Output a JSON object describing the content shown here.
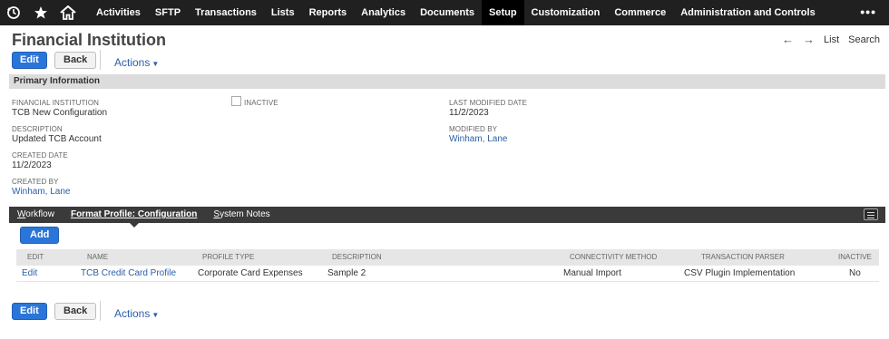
{
  "nav": {
    "icons": [
      "recent-icon",
      "star-icon",
      "home-icon"
    ],
    "items": [
      "Activities",
      "SFTP",
      "Transactions",
      "Lists",
      "Reports",
      "Analytics",
      "Documents",
      "Setup",
      "Customization",
      "Commerce",
      "Administration and Controls"
    ],
    "active_item": "Setup",
    "more": "•••"
  },
  "page": {
    "title": "Financial Institution",
    "right_nav": {
      "list": "List",
      "search": "Search"
    }
  },
  "toolbar": {
    "edit": "Edit",
    "back": "Back",
    "actions": "Actions"
  },
  "primary": {
    "header": "Primary Information",
    "financial_institution_label": "FINANCIAL INSTITUTION",
    "financial_institution_value": "TCB New Configuration",
    "description_label": "DESCRIPTION",
    "description_value": "Updated TCB Account",
    "created_date_label": "CREATED DATE",
    "created_date_value": "11/2/2023",
    "created_by_label": "CREATED BY",
    "created_by_value": "Winham, Lane",
    "inactive_label": "INACTIVE",
    "last_modified_label": "LAST MODIFIED DATE",
    "last_modified_value": "11/2/2023",
    "modified_by_label": "MODIFIED BY",
    "modified_by_value": "Winham, Lane"
  },
  "subtabs": {
    "workflow_first": "W",
    "workflow_rest": "orkflow",
    "format_profile_first": "F",
    "format_profile_rest": "ormat Profile: Configuration",
    "system_notes_first": "S",
    "system_notes_rest": "ystem Notes"
  },
  "sublist": {
    "add": "Add",
    "columns": [
      "EDIT",
      "NAME",
      "PROFILE TYPE",
      "DESCRIPTION",
      "CONNECTIVITY METHOD",
      "TRANSACTION PARSER",
      "INACTIVE"
    ],
    "rows": [
      [
        "Edit",
        "TCB Credit Card Profile",
        "Corporate Card Expenses",
        "Sample 2",
        "Manual Import",
        "CSV Plugin Implementation",
        "No"
      ]
    ]
  },
  "colors": {
    "nav_bg": "#202020",
    "primary_button": "#2a76d8",
    "link": "#2b5fa6",
    "section_bg": "#dcdcdc",
    "subtab_bg": "#3a3a3a"
  }
}
